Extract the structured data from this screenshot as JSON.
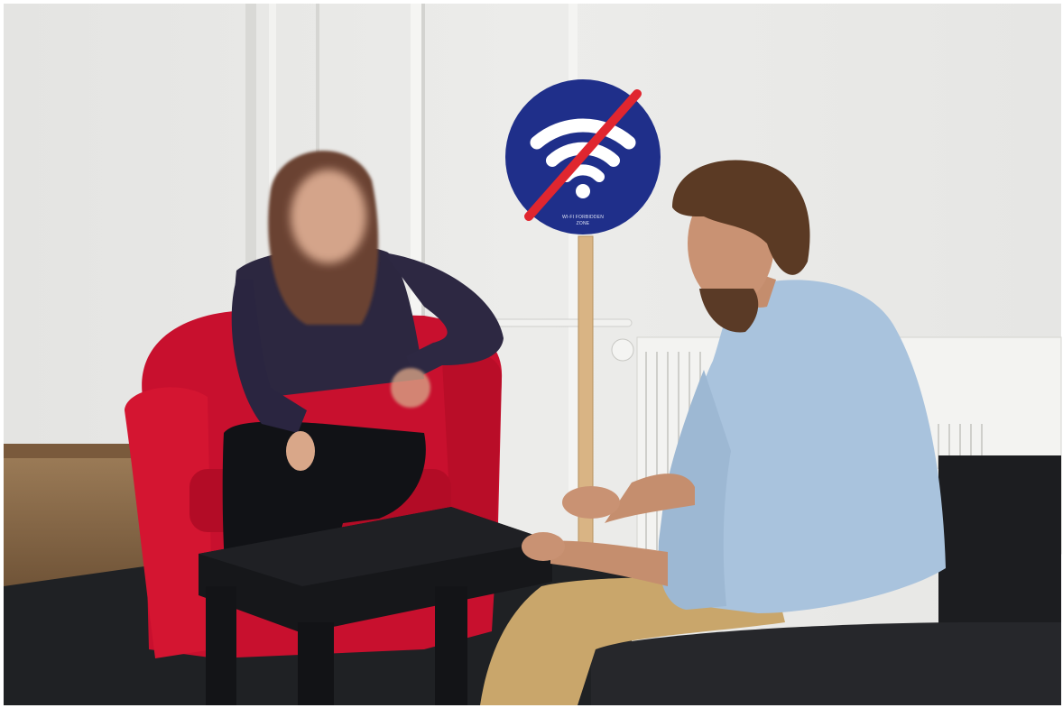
{
  "photo": {
    "colors": {
      "wall": "#e9e9e7",
      "floor_wood": "#8a6a4a",
      "carpet": "#1f2124",
      "armchair": "#c8102e",
      "sign_blue": "#1f2f8a",
      "sign_slash": "#e0262f",
      "table": "#16171a",
      "sofa": "#1c1d20",
      "shirt_blue": "#a9c3dd",
      "khaki": "#c9a66b",
      "top_purple": "#2c2740"
    },
    "sign": {
      "icon": "wifi-crossed-icon",
      "text_line1": "WI-FI FORBIDDEN",
      "text_line2": "ZONE"
    }
  }
}
